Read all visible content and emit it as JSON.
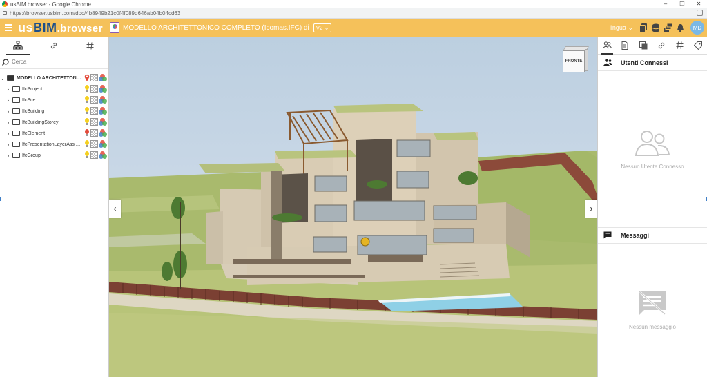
{
  "browser": {
    "title": "usBIM.browser - Google Chrome",
    "url": "https://browser.usbim.com/doc/4b8949b21c0f4f089d646ab04b04cd63"
  },
  "window_controls": {
    "minimize": "–",
    "restore": "❐",
    "close": "✕"
  },
  "appbar": {
    "logo_us": "us",
    "logo_bim": "BIM",
    "logo_browser": ".browser",
    "document_title": "MODELLO ARCHITETTONICO COMPLETO (Icomas.IFC) di",
    "version": "V2",
    "language": "lingua",
    "user_initials": "MD"
  },
  "left_panel": {
    "search_placeholder": "Cerca",
    "tree": {
      "root": "MODELLO ARCHITETTONIC...",
      "children": [
        {
          "label": "IfcProject",
          "bulb": "yellow"
        },
        {
          "label": "IfcSite",
          "bulb": "yellow"
        },
        {
          "label": "IfcBuilding",
          "bulb": "yellow"
        },
        {
          "label": "IfcBuildingStorey",
          "bulb": "yellow"
        },
        {
          "label": "IfcElement",
          "bulb": "red"
        },
        {
          "label": "IfcPresentationLayerAssig...",
          "bulb": "yellow"
        },
        {
          "label": "IfcGroup",
          "bulb": "yellow"
        }
      ]
    }
  },
  "viewport": {
    "navcube_label": "FRONTE",
    "prev": "‹",
    "next": "›"
  },
  "right_panel": {
    "users_title": "Utenti Connessi",
    "users_empty": "Nessun Utente Connesso",
    "messages_title": "Messaggi",
    "messages_empty": "Nessun messaggio"
  },
  "colors": {
    "appbar": "#f5c15a",
    "logo_bim": "#1c4f8a",
    "avatar": "#7ab8e5"
  }
}
